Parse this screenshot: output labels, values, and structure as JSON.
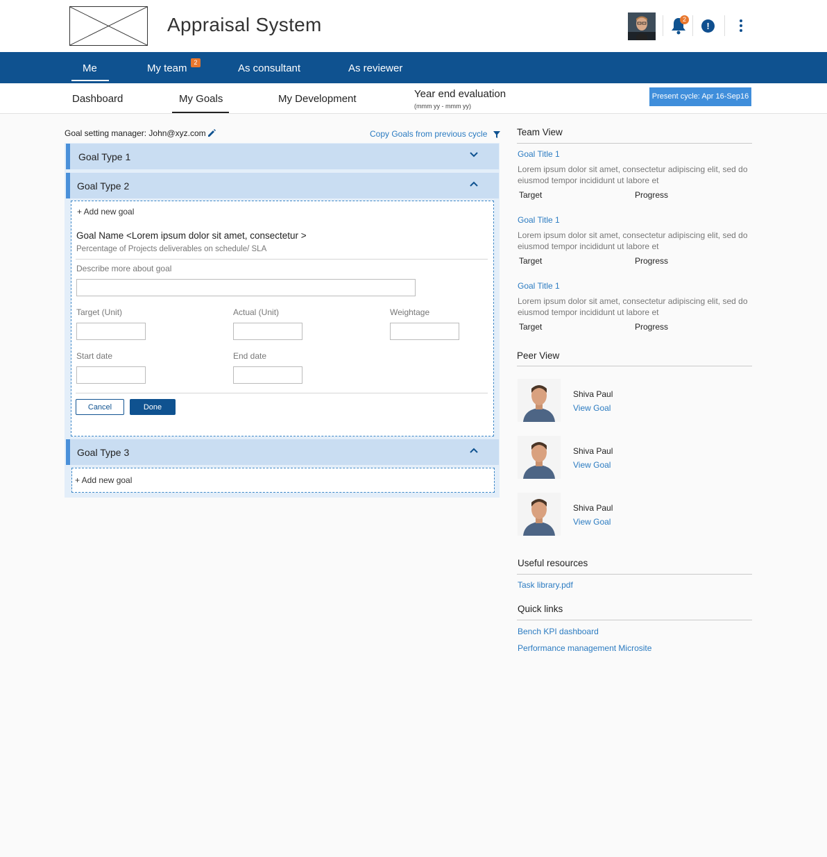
{
  "header": {
    "app_title": "Appraisal System",
    "notification_count": "2",
    "alert_glyph": "!"
  },
  "nav": {
    "items": [
      {
        "label": "Me",
        "active": true
      },
      {
        "label": "My team",
        "badge": "2"
      },
      {
        "label": "As consultant"
      },
      {
        "label": "As reviewer"
      }
    ]
  },
  "subnav": {
    "items": [
      {
        "label": "Dashboard"
      },
      {
        "label": "My Goals",
        "active": true
      },
      {
        "label": "My Development"
      },
      {
        "label": "Year end evaluation",
        "sublabel": "(mmm yy - mmm yy)"
      }
    ],
    "cycle_button": "Present cycle: Apr 16-Sep16"
  },
  "goals": {
    "manager_text": "Goal setting manager: John@xyz.com",
    "copy_link": "Copy Goals from previous cycle",
    "types": [
      {
        "label": "Goal Type 1",
        "expanded": false
      },
      {
        "label": "Goal Type 2",
        "expanded": true
      },
      {
        "label": "Goal Type 3",
        "expanded": true
      }
    ],
    "add_new_goal": "+ Add new goal",
    "goal_name": "Goal Name <Lorem ipsum dolor sit amet, consectetur >",
    "goal_subtitle": "Percentage of Projects deliverables on schedule/ SLA",
    "describe_label": "Describe more about goal",
    "target_label": "Target (Unit)",
    "actual_label": "Actual (Unit)",
    "weightage_label": "Weightage",
    "start_label": "Start date",
    "end_label": "End date",
    "cancel_label": "Cancel",
    "done_label": "Done"
  },
  "team_view": {
    "title": "Team View",
    "items": [
      {
        "title": "Goal Title 1",
        "desc": "Lorem ipsum dolor sit amet, consectetur adipiscing elit, sed do eiusmod tempor incididunt ut labore et",
        "target": "Target",
        "progress": "Progress"
      },
      {
        "title": "Goal Title 1",
        "desc": "Lorem ipsum dolor sit amet, consectetur adipiscing elit, sed do eiusmod tempor incididunt ut labore et",
        "target": "Target",
        "progress": "Progress"
      },
      {
        "title": "Goal Title 1",
        "desc": "Lorem ipsum dolor sit amet, consectetur adipiscing elit, sed do eiusmod tempor incididunt ut labore et",
        "target": "Target",
        "progress": "Progress"
      }
    ]
  },
  "peer_view": {
    "title": "Peer View",
    "items": [
      {
        "name": "Shiva Paul",
        "link": "View Goal"
      },
      {
        "name": "Shiva Paul",
        "link": "View Goal"
      },
      {
        "name": "Shiva Paul",
        "link": "View Goal"
      }
    ]
  },
  "resources": {
    "title": "Useful resources",
    "links": [
      "Task library.pdf"
    ]
  },
  "quick_links": {
    "title": "Quick links",
    "links": [
      "Bench KPI dashboard",
      "Performance management Microsite"
    ]
  },
  "colors": {
    "nav_blue": "#0f5290",
    "link_blue": "#2b7bc1",
    "badge_orange": "#e8772e",
    "goal_bar": "#c9ddf2"
  }
}
